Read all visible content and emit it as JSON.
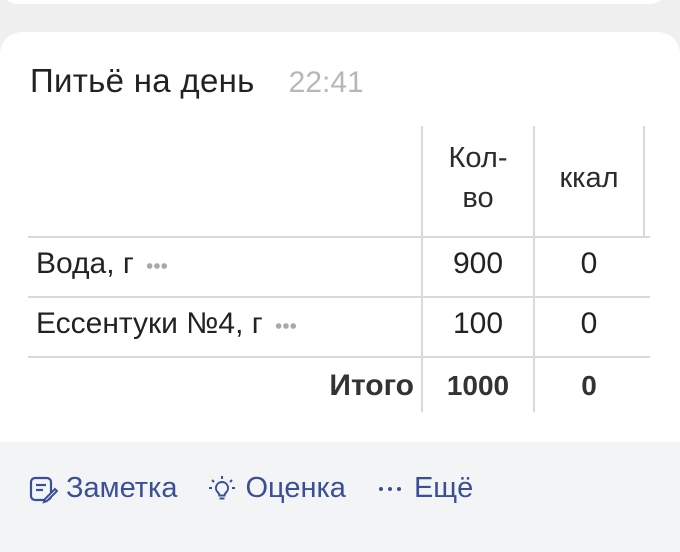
{
  "card": {
    "title": "Питьё на день",
    "time": "22:41"
  },
  "table": {
    "headers": {
      "qty": "Кол-\nво",
      "kcal": "ккал"
    },
    "rows": [
      {
        "name": "Вода, г",
        "qty": "900",
        "kcal": "0"
      },
      {
        "name": "Ессентуки №4, г",
        "qty": "100",
        "kcal": "0"
      }
    ],
    "total": {
      "label": "Итого",
      "qty": "1000",
      "kcal": "0"
    }
  },
  "actions": {
    "note": "Заметка",
    "rating": "Оценка",
    "more": "Ещё"
  },
  "colors": {
    "accent": "#3a4f96",
    "muted": "#b7b7b7",
    "divider": "#d9d9d9"
  }
}
